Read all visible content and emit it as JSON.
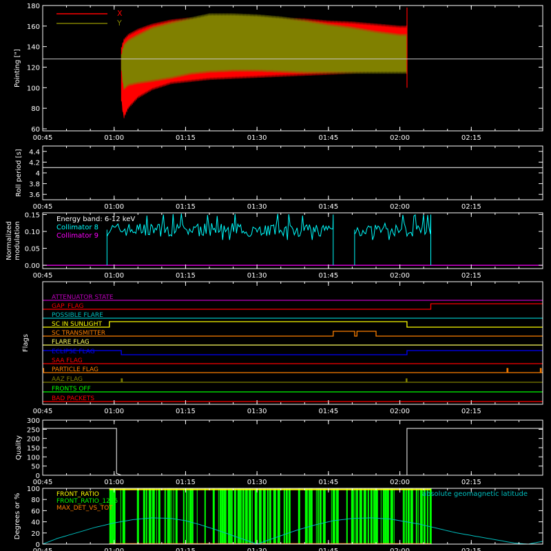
{
  "colors": {
    "background": "#000000",
    "axes": "#ffffff",
    "x_series": "#ff0000",
    "y_series": "#808000",
    "collimator8": "#00ffff",
    "collimator9": "#ff00ff",
    "front_ratio": "#ffff00",
    "front_ratio_1225": "#00ff00",
    "max_det_vs_tot": "#ff8000",
    "geomag": "#00bfbf"
  },
  "time_axis": {
    "range_minutes": [
      45,
      150
    ],
    "tick_minutes": [
      45,
      60,
      75,
      90,
      105,
      120,
      135
    ],
    "tick_labels": [
      "00:45",
      "01:00",
      "01:15",
      "01:30",
      "01:45",
      "02:00",
      "02:15"
    ]
  },
  "chart_data": [
    {
      "type": "area",
      "ylabel": "Pointing [\"]",
      "ylim": [
        58,
        180
      ],
      "yticks": [
        60,
        80,
        100,
        120,
        140,
        160,
        180
      ],
      "reference_line": 128,
      "legend": [
        "X",
        "Y"
      ],
      "x_minutes": [
        61.5,
        62,
        63,
        65,
        68,
        72,
        76,
        80,
        85,
        90,
        95,
        100,
        105,
        110,
        115,
        120,
        121.5
      ],
      "series": [
        {
          "name": "X",
          "upper": [
            137,
            145,
            150,
            155,
            160,
            164,
            166,
            167,
            167,
            166,
            166,
            165,
            163,
            162,
            160,
            158,
            158
          ],
          "lower": [
            90,
            72,
            82,
            92,
            100,
            106,
            108,
            110,
            111,
            112,
            113,
            114,
            115,
            116,
            117,
            118,
            118
          ]
        },
        {
          "name": "Y",
          "upper": [
            130,
            140,
            145,
            150,
            157,
            162,
            166,
            170,
            170,
            169,
            167,
            164,
            160,
            157,
            153,
            150,
            150
          ],
          "lower": [
            120,
            100,
            104,
            106,
            108,
            111,
            115,
            117,
            118,
            118,
            117,
            116,
            116,
            116,
            116,
            116,
            116
          ]
        }
      ]
    },
    {
      "type": "line",
      "ylabel": "Roll period [s]",
      "ylim": [
        3.5,
        4.5
      ],
      "yticks": [
        3.6,
        3.8,
        4.0,
        4.2,
        4.4
      ],
      "series": [
        {
          "name": "",
          "x": [
            45,
            150
          ],
          "y": [
            4.1,
            4.1
          ]
        }
      ]
    },
    {
      "type": "line",
      "ylabel_lines": [
        "Normalized",
        "modulation"
      ],
      "ylim": [
        -0.01,
        0.155
      ],
      "yticks": [
        0.0,
        0.05,
        0.1,
        0.15
      ],
      "ytick_labels": [
        "0.00",
        "0.05",
        "0.10",
        "0.15"
      ],
      "legend_title": "Energy band: 6-12 keV",
      "series": [
        {
          "name": "Collimator 8",
          "segments": [
            [
              58.5,
              106
            ],
            [
              110.5,
              126.5
            ]
          ],
          "level": 0.105,
          "spread": 0.02
        },
        {
          "name": "Collimator 9",
          "x": [
            45,
            150
          ],
          "y": [
            0,
            0
          ]
        }
      ]
    },
    {
      "type": "line",
      "ylabel": "Flags",
      "flags": [
        {
          "name": "ATTENUATOR STATE",
          "color": "#c000c0",
          "points": [
            [
              45,
              0
            ],
            [
              150,
              0
            ]
          ]
        },
        {
          "name": "GAP_FLAG",
          "color": "#ff0000",
          "points": [
            [
              45,
              0
            ],
            [
              126.5,
              0
            ],
            [
              126.5,
              1
            ],
            [
              150,
              1
            ]
          ]
        },
        {
          "name": "POSSIBLE FLARE",
          "color": "#00c0c0",
          "points": [
            [
              45,
              0
            ],
            [
              150,
              0
            ]
          ]
        },
        {
          "name": "SC IN SUNLIGHT",
          "color": "#ffff00",
          "points": [
            [
              45,
              0
            ],
            [
              59,
              0
            ],
            [
              59,
              1
            ],
            [
              121.5,
              1
            ],
            [
              121.5,
              0
            ],
            [
              150,
              0
            ]
          ]
        },
        {
          "name": "SC TRANSMITTER",
          "color": "#ff8000",
          "points": [
            [
              45,
              0
            ],
            [
              106,
              0
            ],
            [
              106,
              1
            ],
            [
              110.5,
              1
            ],
            [
              110.5,
              0
            ],
            [
              111,
              0
            ],
            [
              111,
              1
            ],
            [
              115,
              1
            ],
            [
              115,
              0
            ],
            [
              150,
              0
            ]
          ]
        },
        {
          "name": "FLARE FLAG",
          "color": "#ffff60",
          "points": [
            [
              45,
              0
            ],
            [
              150,
              0
            ]
          ]
        },
        {
          "name": "ECLIPSE FLAG",
          "color": "#0000ff",
          "points": [
            [
              45,
              1
            ],
            [
              61.5,
              1
            ],
            [
              61.5,
              0
            ],
            [
              121.5,
              0
            ],
            [
              121.5,
              1
            ],
            [
              150,
              1
            ]
          ]
        },
        {
          "name": "SAA FLAG",
          "color": "#ff0000",
          "points": [
            [
              45,
              0
            ],
            [
              150,
              0
            ]
          ]
        },
        {
          "name": "PARTICLE FLAG",
          "color": "#ff8000",
          "points": [
            [
              45,
              1
            ],
            [
              45.2,
              1
            ],
            [
              45.2,
              0
            ],
            [
              142.5,
              0
            ],
            [
              142.5,
              1
            ],
            [
              142.7,
              1
            ],
            [
              142.7,
              0
            ],
            [
              149.5,
              0
            ],
            [
              149.5,
              1
            ],
            [
              149.7,
              1
            ],
            [
              149.7,
              0
            ],
            [
              150,
              0
            ]
          ]
        },
        {
          "name": "AAZ FLAG",
          "color": "#808000",
          "points": [
            [
              45,
              0
            ],
            [
              61.5,
              0
            ],
            [
              61.5,
              1
            ],
            [
              61.7,
              1
            ],
            [
              61.7,
              0
            ],
            [
              121.3,
              0
            ],
            [
              121.3,
              1
            ],
            [
              121.5,
              1
            ],
            [
              121.5,
              0
            ],
            [
              150,
              0
            ]
          ]
        },
        {
          "name": "FRONTS OFF",
          "color": "#00ff00",
          "points": [
            [
              45,
              0
            ],
            [
              150,
              0
            ]
          ]
        },
        {
          "name": "BAD PACKETS",
          "color": "#ff0000",
          "points": [
            [
              45,
              0
            ],
            [
              150,
              0
            ]
          ]
        }
      ]
    },
    {
      "type": "line",
      "ylabel": "Quality",
      "ylim": [
        0,
        300
      ],
      "yticks": [
        0,
        50,
        100,
        150,
        200,
        250,
        300
      ],
      "series": [
        {
          "name": "",
          "x": [
            45,
            60.5,
            60.5,
            61.5,
            61.5,
            121.5,
            121.5,
            150
          ],
          "y": [
            255,
            255,
            10,
            0,
            0,
            0,
            255,
            255
          ]
        }
      ]
    },
    {
      "type": "bar",
      "ylabel": "Degrees or %",
      "ylim": [
        0,
        100
      ],
      "yticks": [
        0,
        20,
        40,
        60,
        80,
        100
      ],
      "legend": [
        "FRONT_RATIO",
        "FRONT_RATIO_1225",
        "MAX_DET_VS_TOT"
      ],
      "legend_right": "absolute geomagnetic latitude",
      "bar_range": [
        59,
        126.5
      ],
      "geomagnetic_latitude": {
        "x": [
          45,
          48,
          52,
          56,
          60,
          64,
          68,
          72,
          75,
          78,
          82,
          86,
          90,
          94,
          98,
          102,
          106,
          110,
          114,
          118,
          120,
          124,
          128,
          132,
          136,
          140,
          144,
          147,
          150
        ],
        "y": [
          0,
          10,
          20,
          30,
          38,
          44,
          47,
          46,
          42,
          35,
          24,
          12,
          0,
          12,
          24,
          34,
          42,
          46,
          47,
          45,
          42,
          36,
          28,
          20,
          14,
          8,
          2,
          0,
          5
        ]
      }
    }
  ]
}
